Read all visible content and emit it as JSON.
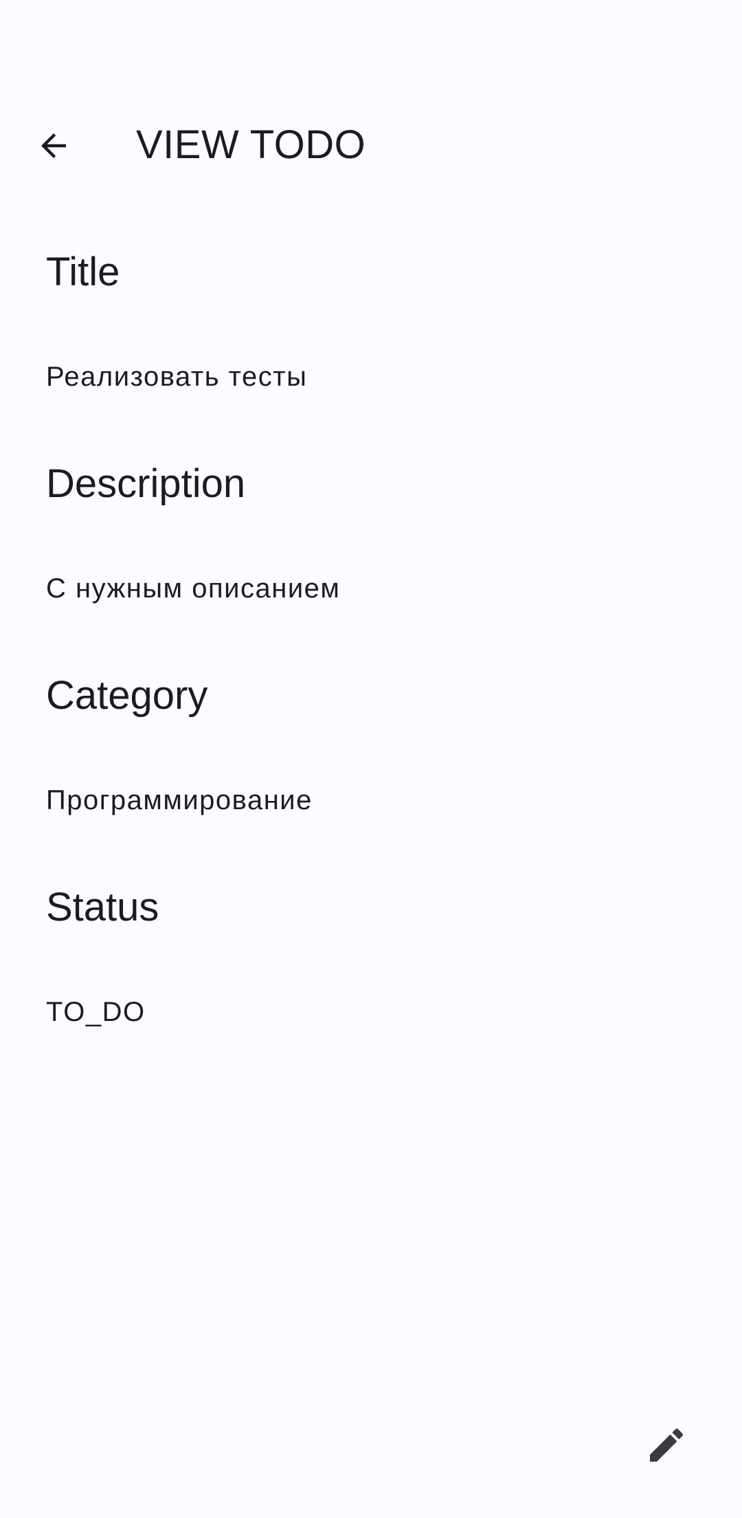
{
  "app_bar": {
    "title": "VIEW TODO",
    "back_icon": "arrow-back-icon"
  },
  "fields": [
    {
      "label": "Title",
      "value": "Реализовать тесты"
    },
    {
      "label": "Description",
      "value": "С нужным описанием"
    },
    {
      "label": "Category",
      "value": "Программирование"
    },
    {
      "label": "Status",
      "value": "TO_DO"
    }
  ],
  "fab": {
    "icon": "edit-pencil-icon"
  },
  "colors": {
    "background": "#fdfbff",
    "text": "#1c1b1f",
    "icon": "#3a3a3f"
  }
}
